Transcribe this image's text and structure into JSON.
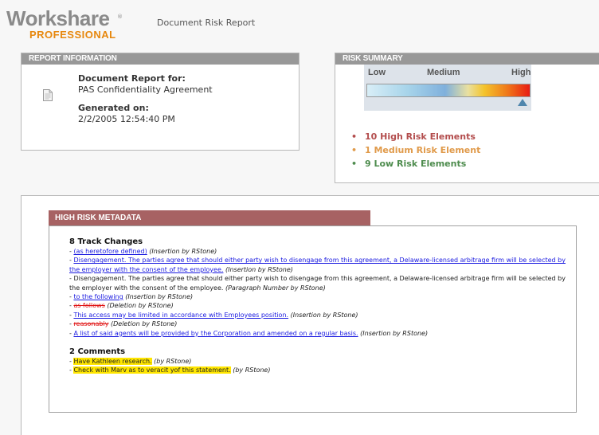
{
  "header": {
    "logo_main": "Workshare",
    "logo_sub": "PROFESSIONAL",
    "title": "Document Risk Report"
  },
  "report_info": {
    "header": "REPORT INFORMATION",
    "label_report_for": "Document Report for:",
    "document_name": "PAS Confidentiality Agreement",
    "label_generated": "Generated on:",
    "generated_date": "2/2/2005 12:54:40 PM"
  },
  "risk_summary": {
    "header": "RISK SUMMARY",
    "scale_low": "Low",
    "scale_medium": "Medium",
    "scale_high": "High",
    "level": "High",
    "items": [
      {
        "text": "10 High Risk Elements",
        "color": "#b34d4d"
      },
      {
        "text": "1 Medium Risk Element",
        "color": "#e09a4a"
      },
      {
        "text": "9 Low Risk Elements",
        "color": "#4e8c4e"
      }
    ]
  },
  "high_risk": {
    "header": "HIGH RISK METADATA",
    "track_changes_title": "8 Track Changes",
    "track_changes": [
      {
        "text": "(as heretofore defined)",
        "style": "ins",
        "note": "(Insertion by RStone)"
      },
      {
        "text": "Disengagement. The parties agree that should either party wish to disengage from this agreement, a Delaware-licensed arbitrage firm will be selected by the employer with the consent of the employee.",
        "style": "ins",
        "note": "(Insertion by RStone)"
      },
      {
        "text": "Disengagement. The parties agree that should either party wish to disengage from this agreement, a Delaware-licensed arbitrage firm will be selected by the employer with the consent of the employee.",
        "style": "plain",
        "note": "(Paragraph Number by RStone)"
      },
      {
        "text": "to the following",
        "style": "ins",
        "note": "(Insertion by RStone)"
      },
      {
        "text": "as follows",
        "style": "del",
        "note": "(Deletion by RStone)"
      },
      {
        "text": "This access may be limited in accordance with Employees position.",
        "style": "ins",
        "note": "(Insertion by RStone)"
      },
      {
        "text": "reasonably",
        "style": "del",
        "note": "(Deletion by RStone)"
      },
      {
        "text": "A list of said agents will be provided by the Corporation and amended on a regular basis.",
        "style": "ins",
        "note": "(Insertion by RStone)"
      }
    ],
    "comments_title": "2 Comments",
    "comments": [
      {
        "text": "Have Kathleen research.",
        "note": "(by RStone)"
      },
      {
        "text": "Check with Marv as to veracit yof this statement.",
        "note": "(by RStone)"
      }
    ]
  },
  "icons": {
    "document": "document-icon"
  }
}
